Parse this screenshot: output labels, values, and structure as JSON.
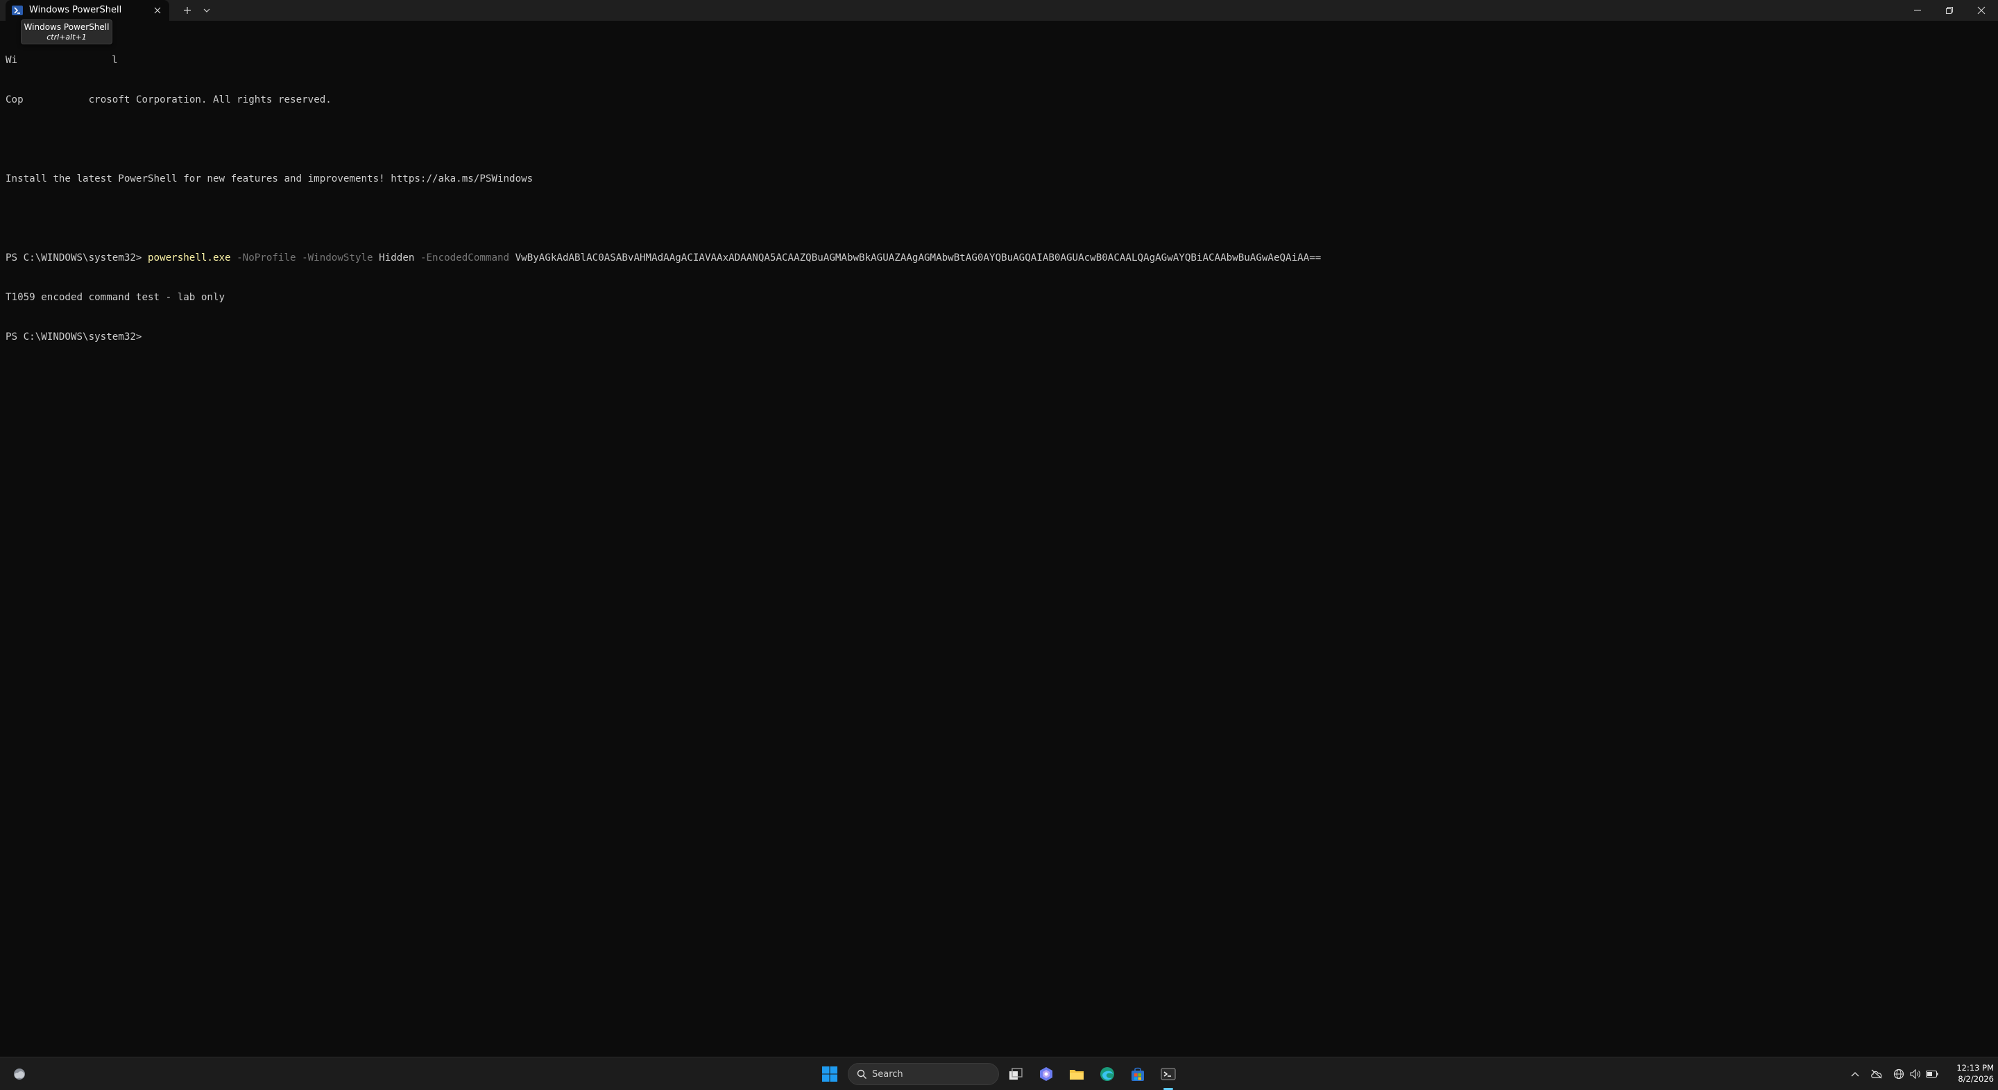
{
  "window": {
    "tab_title": "Windows PowerShell",
    "tooltip": {
      "title": "Windows PowerShell",
      "shortcut": "ctrl+alt+1"
    },
    "icons": {
      "tab": "powershell-icon",
      "close_tab": "close-icon",
      "new_tab": "plus-icon",
      "dropdown": "chevron-down-icon",
      "minimize": "minimize-icon",
      "maximize": "restore-icon",
      "close": "close-icon"
    }
  },
  "terminal": {
    "line1_prefix": "Wi",
    "line1_suffix": "l",
    "line2_prefix": "Cop",
    "line2_suffix": "crosoft Corporation. All rights reserved.",
    "line3": "",
    "line4": "Install the latest PowerShell for new features and improvements! https://aka.ms/PSWindows",
    "line5": "",
    "line6": {
      "prompt": "PS C:\\WINDOWS\\system32> ",
      "command": "powershell.exe",
      "p1": " -NoProfile",
      "p2": " -WindowStyle",
      "a2": " Hidden",
      "p3": " -EncodedCommand",
      "a3": " VwByAGkAdABlAC0ASABvAHMAdAAgACIAVAAxADAANQA5ACAAZQBuAGMAbwBkAGUAZAAgAGMAbwBtAG0AYQBuAGQAIAB0AGUAcwB0ACAALQAgAGwAYQBiACAAbwBuAGwAeQAiAA=="
    },
    "line7": "T1059 encoded command test - lab only",
    "line8": "PS C:\\WINDOWS\\system32> "
  },
  "taskbar": {
    "search_placeholder": "Search",
    "time": "12:13 PM",
    "date": "8/2/2026",
    "icons": {
      "widgets": "weather-icon",
      "start": "windows-start-icon",
      "search": "search-icon",
      "task_view": "task-view-icon",
      "copilot": "copilot-icon",
      "explorer": "folder-icon",
      "edge": "edge-browser-icon",
      "store": "store-icon",
      "terminal": "terminal-icon",
      "tray_overflow": "chevron-up-icon",
      "onedrive": "cloud-offline-icon",
      "network": "network-icon",
      "volume": "volume-icon",
      "battery": "battery-icon"
    },
    "colors": {
      "start_blue": "#1f9bf0",
      "active_indicator": "#60cdff"
    }
  },
  "colors": {
    "terminal_bg": "#0c0c0c",
    "terminal_fg": "#cccccc",
    "command_yellow": "#f9f1a5",
    "param_gray": "#767676"
  }
}
